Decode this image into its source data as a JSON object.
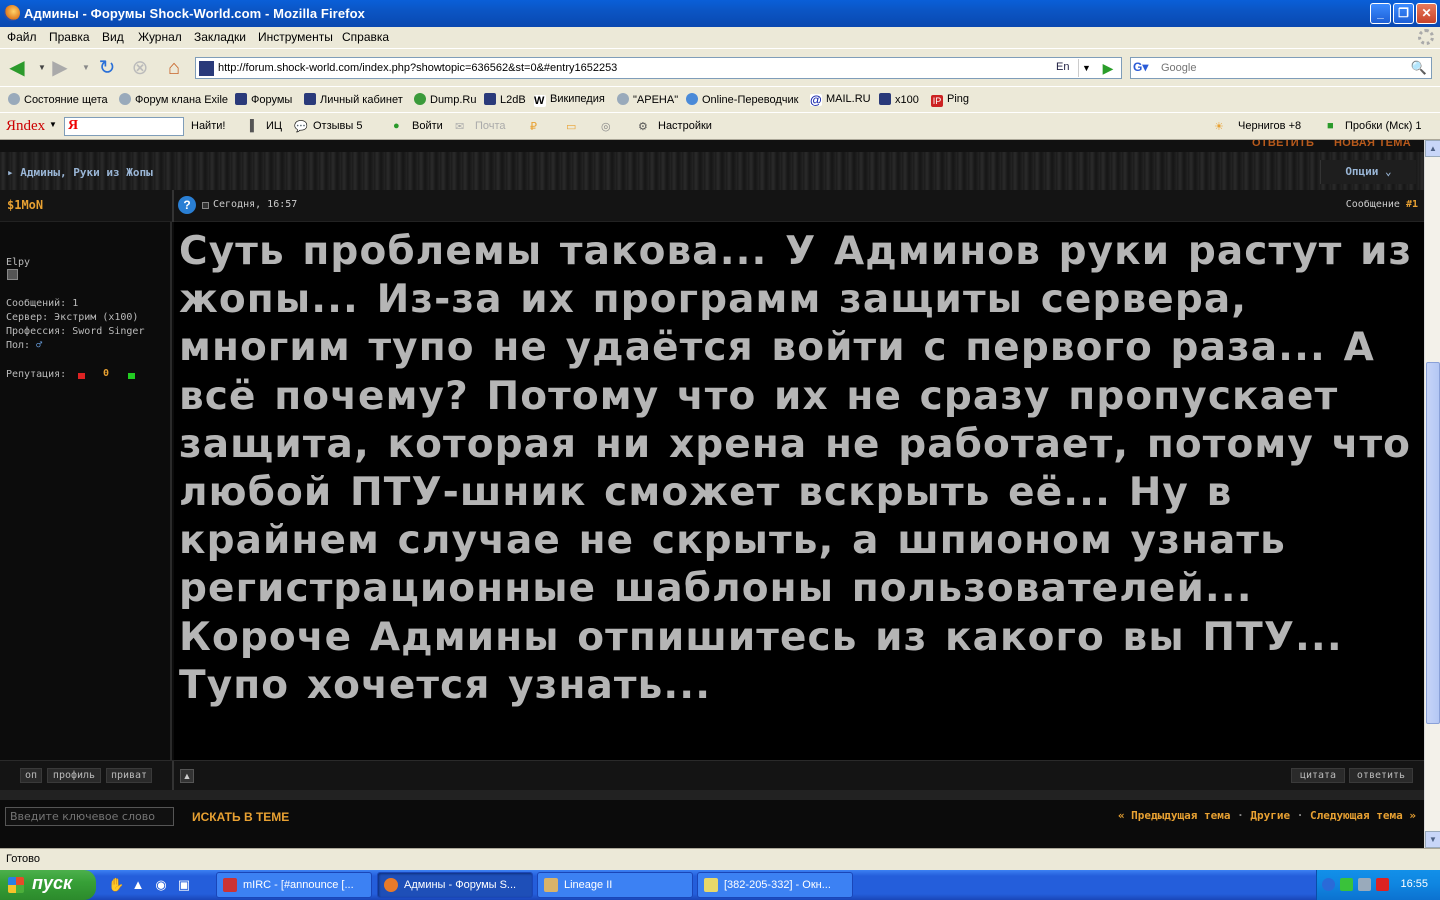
{
  "window": {
    "title": "Админы - Форумы Shock-World.com - Mozilla Firefox"
  },
  "menu": [
    "Файл",
    "Правка",
    "Вид",
    "Журнал",
    "Закладки",
    "Инструменты",
    "Справка"
  ],
  "navbar": {
    "url": "http://forum.shock-world.com/index.php?showtopic=636562&st=0&#entry1652253",
    "lang": "En",
    "search_placeholder": "Google"
  },
  "bookmarks": [
    "Состояние щета",
    "Форум клана Exile",
    "Форумы",
    "Личный кабинет",
    "Dump.Ru",
    "L2dB",
    "Википедия",
    "\"АРЕНА\"",
    "Online-Переводчик",
    "MAIL.RU",
    "x100",
    "Ping"
  ],
  "yandex": {
    "logo": "Яndex",
    "find": "Найти!",
    "ic": "ИЦ",
    "reviews": "Отзывы 5",
    "login": "Войти",
    "mail": "Почта",
    "settings": "Настройки",
    "weather": "Чернигов +8",
    "traffic": "Пробки (Мск) 1"
  },
  "page": {
    "top_links": {
      "reply": "ОТВЕТИТЬ",
      "new_topic": "НОВАЯ ТЕМА"
    },
    "thread_title": "Админы, Руки из Жопы",
    "options": "Опции",
    "post": {
      "author": "$1MoN",
      "date": "Сегодня, 16:57",
      "message_label": "Сообщение",
      "message_num": "#1",
      "rank": "Elpy",
      "posts": "Сообщений: 1",
      "server": "Сервер: Экстрим (x100)",
      "profession": "Профессия: Sword Singer",
      "gender": "Пол:",
      "reputation_label": "Репутация:",
      "reputation_value": "0",
      "body": "Суть проблемы такова... У Админов руки растут из жопы... Из-за их программ защиты сервера, многим тупо не удаётся войти с первого раза... А всё почему? Потому что их не сразу пропускает защита, которая ни хрена не работает, потому что любой ПТУ-шник сможет вскрыть её... Ну в крайнем случае не скрыть, а шпионом узнать регистрационные шаблоны пользователей... Короче Админы отпишитесь из какого вы ПТУ... Тупо хочется узнать..."
    },
    "post_buttons": {
      "online": "оп",
      "profile": "профиль",
      "private": "приват",
      "quote": "цитата",
      "reply": "ответить"
    },
    "search_placeholder": "Введите ключевое слово",
    "search_button": "ИСКАТЬ В ТЕМЕ",
    "nav": {
      "prev": "« Предыдущая тема",
      "other": "Другие",
      "next": "Следующая тема »"
    }
  },
  "status": "Готово",
  "taskbar": {
    "start": "пуск",
    "tasks": [
      "mIRC - [#announce [...",
      "Админы - Форумы S...",
      "Lineage II",
      "[382-205-332] - Окн..."
    ],
    "clock": "16:55"
  },
  "colors": {
    "accent": "#e8a132",
    "post_text": "#b5b5b5",
    "link_blue": "#9ab6d6"
  }
}
